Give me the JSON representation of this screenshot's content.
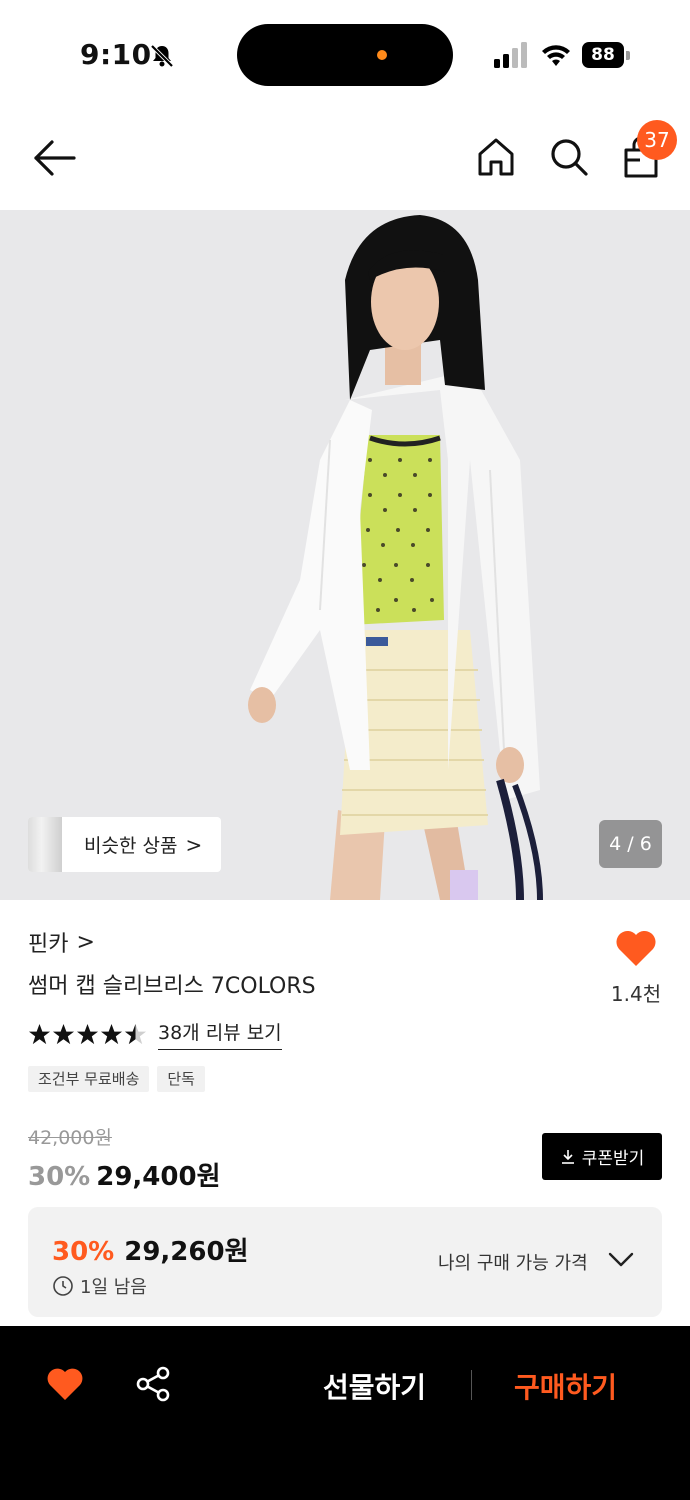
{
  "status_bar": {
    "time": "9:10",
    "battery": "88"
  },
  "header": {
    "icons": [
      "back-arrow-icon",
      "home-icon",
      "search-icon",
      "shopping-bag-icon"
    ],
    "cart_count": "37"
  },
  "gallery": {
    "similar_label": "비슷한 상품",
    "similar_chevron": ">",
    "page_indicator": "4 / 6"
  },
  "product": {
    "brand": "핀카",
    "brand_chevron": ">",
    "name": "썸머 캡 슬리브리스 7COLORS",
    "like_count": "1.4천",
    "rating": 4.5,
    "review_link": "38개 리뷰 보기",
    "tags": [
      "조건부 무료배송",
      "단독"
    ],
    "original_price": "42,000원",
    "discount": "30%",
    "sale_price": "29,400원",
    "coupon_label": "쿠폰받기"
  },
  "best_price": {
    "discount": "30%",
    "price": "29,260원",
    "timer": "1일 남음",
    "label": "나의 구매 가능 가격"
  },
  "bottom_bar": {
    "gift_label": "선물하기",
    "buy_label": "구매하기"
  },
  "colors": {
    "accent": "#ff5a1f",
    "black": "#000000",
    "muted": "#999999"
  }
}
